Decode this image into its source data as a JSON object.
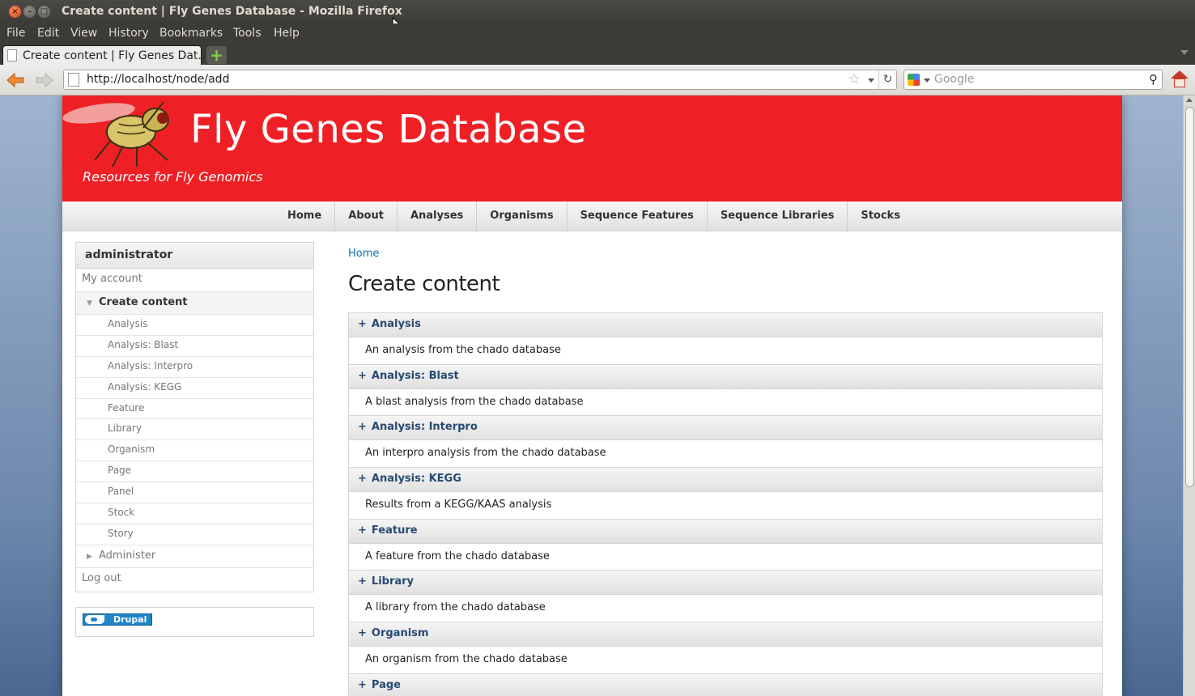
{
  "window": {
    "title": "Create content | Fly Genes Database - Mozilla Firefox"
  },
  "menubar": [
    "File",
    "Edit",
    "View",
    "History",
    "Bookmarks",
    "Tools",
    "Help"
  ],
  "tab": {
    "label": "Create content | Fly Genes Dat…"
  },
  "navbar": {
    "url": "http://localhost/node/add",
    "search_placeholder": "Google"
  },
  "site": {
    "name": "Fly Genes Database",
    "slogan": "Resources for Fly Genomics",
    "header_color": "#ee2025"
  },
  "primary_nav": [
    "Home",
    "About",
    "Analyses",
    "Organisms",
    "Sequence Features",
    "Sequence Libraries",
    "Stocks"
  ],
  "sidebar": {
    "title": "administrator",
    "my_account": "My account",
    "create_content": "Create content",
    "create_items": [
      "Analysis",
      "Analysis: Blast",
      "Analysis: Interpro",
      "Analysis: KEGG",
      "Feature",
      "Library",
      "Organism",
      "Page",
      "Panel",
      "Stock",
      "Story"
    ],
    "administer": "Administer",
    "logout": "Log out",
    "powered_by": "Drupal"
  },
  "main": {
    "breadcrumb": "Home",
    "title": "Create content",
    "node_types": [
      {
        "name": "Analysis",
        "description": "An analysis from the chado database"
      },
      {
        "name": "Analysis: Blast",
        "description": "A blast analysis from the chado database"
      },
      {
        "name": "Analysis: Interpro",
        "description": "An interpro analysis from the chado database"
      },
      {
        "name": "Analysis: KEGG",
        "description": "Results from a KEGG/KAAS analysis"
      },
      {
        "name": "Feature",
        "description": "A feature from the chado database"
      },
      {
        "name": "Library",
        "description": "A library from the chado database"
      },
      {
        "name": "Organism",
        "description": "An organism from the chado database"
      },
      {
        "name": "Page",
        "description": ""
      }
    ]
  }
}
